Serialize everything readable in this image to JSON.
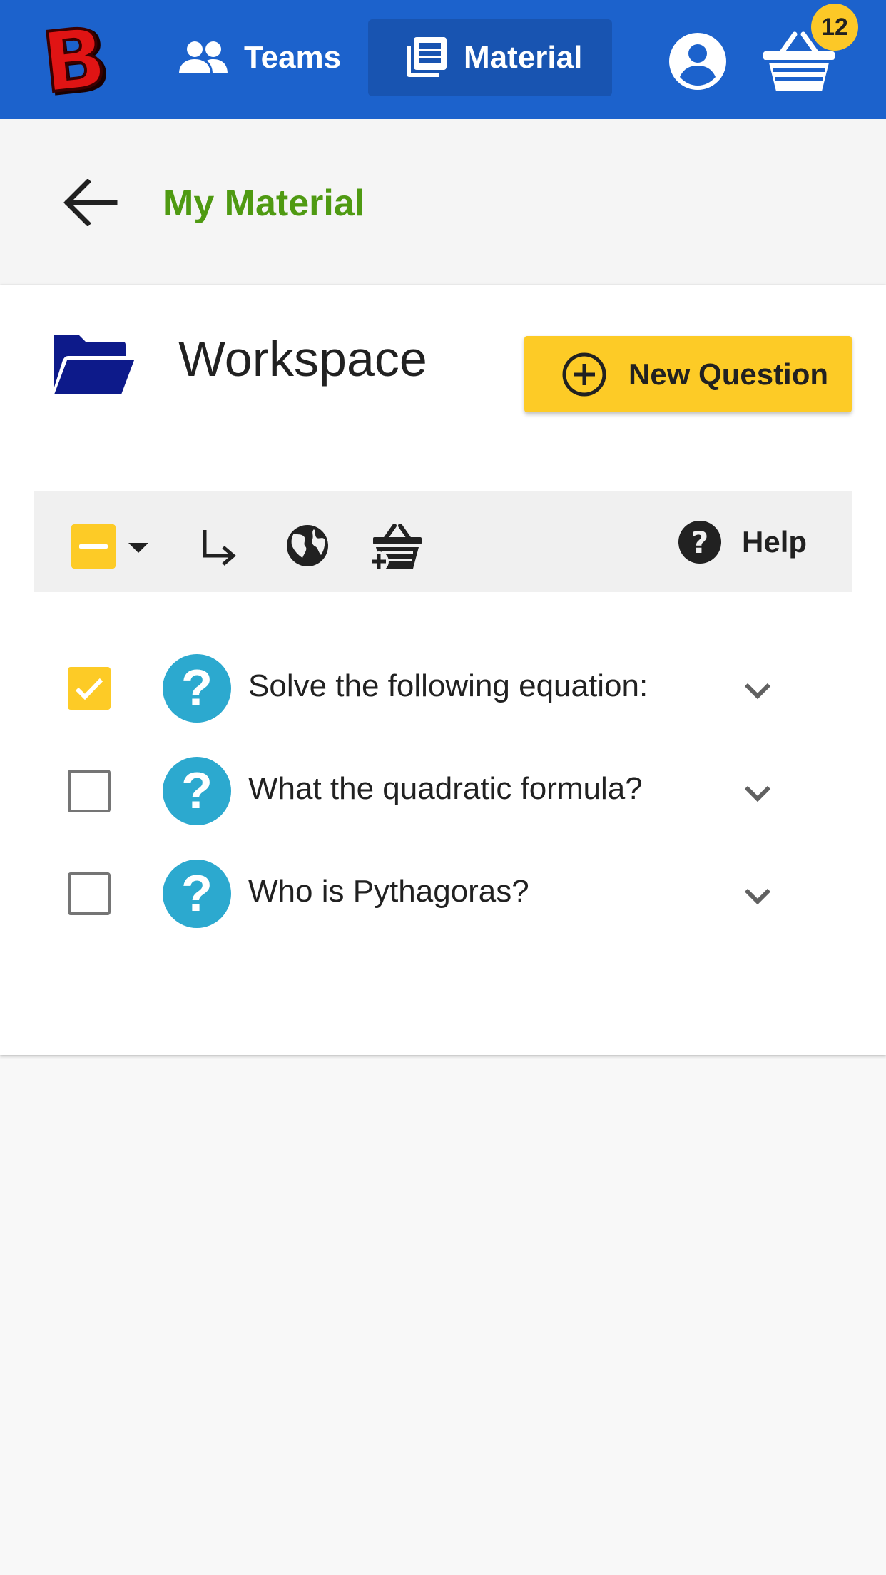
{
  "app": {
    "logo_letter": "B",
    "nav": [
      {
        "label": "Teams",
        "icon": "people-icon",
        "active": false
      },
      {
        "label": "Material",
        "icon": "newspaper-icon",
        "active": true
      }
    ],
    "basket_count": "12",
    "colors": {
      "primary": "#1c62cc",
      "active_nav": "#1854b1",
      "accent": "#fdcb26",
      "title_green": "#4f9a12",
      "question_icon": "#2ca9cf",
      "folder_icon": "#0d1a8a"
    }
  },
  "header": {
    "title": "My Material",
    "back_icon": "arrow-left-icon"
  },
  "workspace": {
    "title": "Workspace",
    "icon": "folder-open-icon",
    "new_question_label": "New Question"
  },
  "toolbar": {
    "select_state": "indeterminate",
    "help_label": "Help",
    "icons": [
      "select-all-checkbox-icon",
      "caret-down-icon",
      "move-arrow-icon",
      "globe-icon",
      "basket-add-icon",
      "help-circle-icon"
    ]
  },
  "questions": [
    {
      "text": "Solve the following equation:",
      "checked": true
    },
    {
      "text": "What the quadratic formula?",
      "checked": false
    },
    {
      "text": "Who is Pythagoras?",
      "checked": false
    }
  ]
}
